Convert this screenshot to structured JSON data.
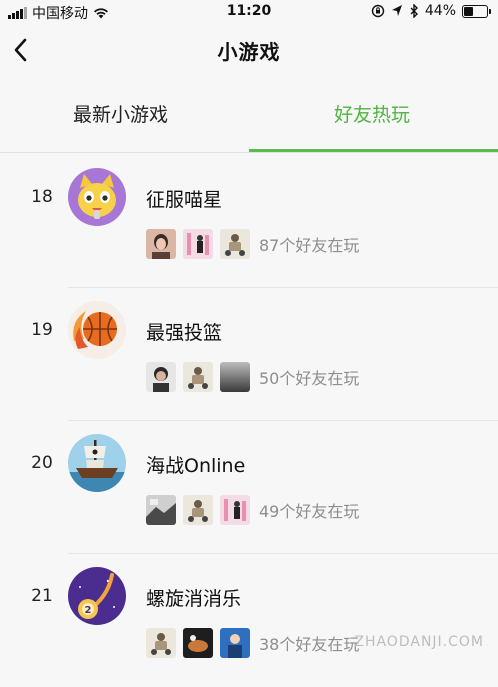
{
  "status_bar": {
    "carrier": "中国移动",
    "time": "11:20",
    "battery": "44%",
    "battery_level": 0.44
  },
  "nav": {
    "title": "小游戏"
  },
  "tabs": [
    {
      "label": "最新小游戏",
      "active": false
    },
    {
      "label": "好友热玩",
      "active": true
    }
  ],
  "colors": {
    "accent": "#4fb441",
    "background": "#f7f7f7",
    "secondary_text": "#8e8e8e"
  },
  "games": [
    {
      "rank": "18",
      "name": "征服喵星",
      "friends_text": "87个好友在玩",
      "icon": "cat-game-icon"
    },
    {
      "rank": "19",
      "name": "最强投篮",
      "friends_text": "50个好友在玩",
      "icon": "basketball-icon"
    },
    {
      "rank": "20",
      "name": "海战Online",
      "friends_text": "49个好友在玩",
      "icon": "pirate-ship-icon"
    },
    {
      "rank": "21",
      "name": "螺旋消消乐",
      "friends_text": "38个好友在玩",
      "icon": "spiral-ball-icon"
    }
  ],
  "watermark": "ZHAODANJI.COM"
}
